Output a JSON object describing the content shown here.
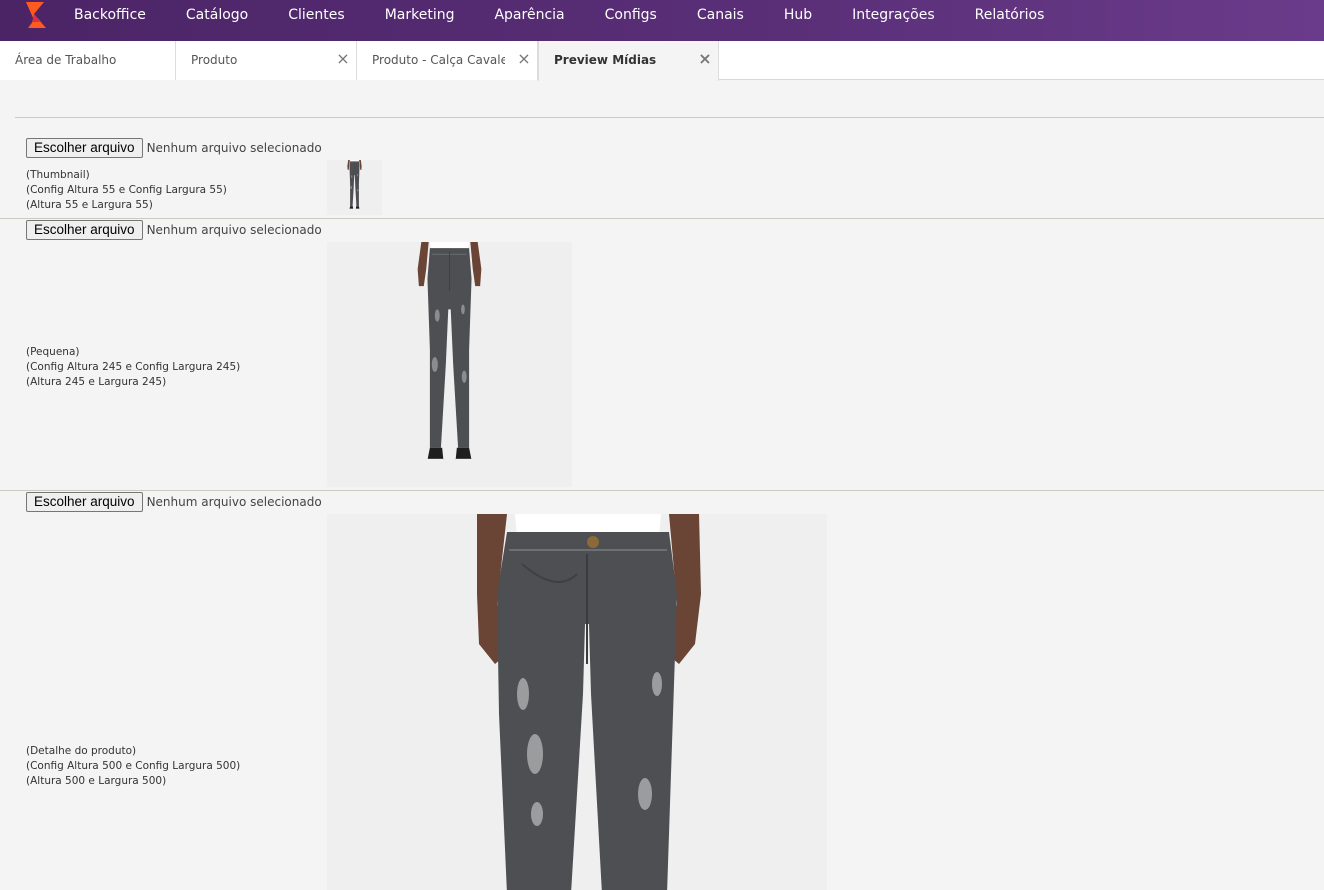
{
  "nav": {
    "items": [
      "Backoffice",
      "Catálogo",
      "Clientes",
      "Marketing",
      "Aparência",
      "Configs",
      "Canais",
      "Hub",
      "Integrações",
      "Relatórios"
    ]
  },
  "tabs": [
    {
      "label": "Área de Trabalho",
      "closable": false,
      "active": false
    },
    {
      "label": "Produto",
      "closable": true,
      "active": false
    },
    {
      "label": "Produto - Calça Cavalera I",
      "closable": true,
      "active": false
    },
    {
      "label": "Preview Mídias",
      "closable": true,
      "active": true
    }
  ],
  "close_glyph": "×",
  "media": [
    {
      "button_label": "Escolher arquivo",
      "file_status": "Nenhum arquivo selecionado",
      "desc": [
        "(Thumbnail)",
        "(Config Altura 55 e Config Largura 55)",
        "(Altura 55 e Largura 55)"
      ]
    },
    {
      "button_label": "Escolher arquivo",
      "file_status": "Nenhum arquivo selecionado",
      "desc": [
        "(Pequena)",
        "(Config Altura 245 e Config Largura 245)",
        "(Altura 245 e Largura 245)"
      ]
    },
    {
      "button_label": "Escolher arquivo",
      "file_status": "Nenhum arquivo selecionado",
      "desc": [
        "(Detalhe do produto)",
        "(Config Altura 500 e Config Largura 500)",
        "(Altura 500 e Largura 500)"
      ]
    }
  ],
  "colors": {
    "nav_bg": "#56297a",
    "logo_accent": "#ff5a1f",
    "page_bg": "#f4f4f4",
    "jeans": "#4d4f52"
  }
}
